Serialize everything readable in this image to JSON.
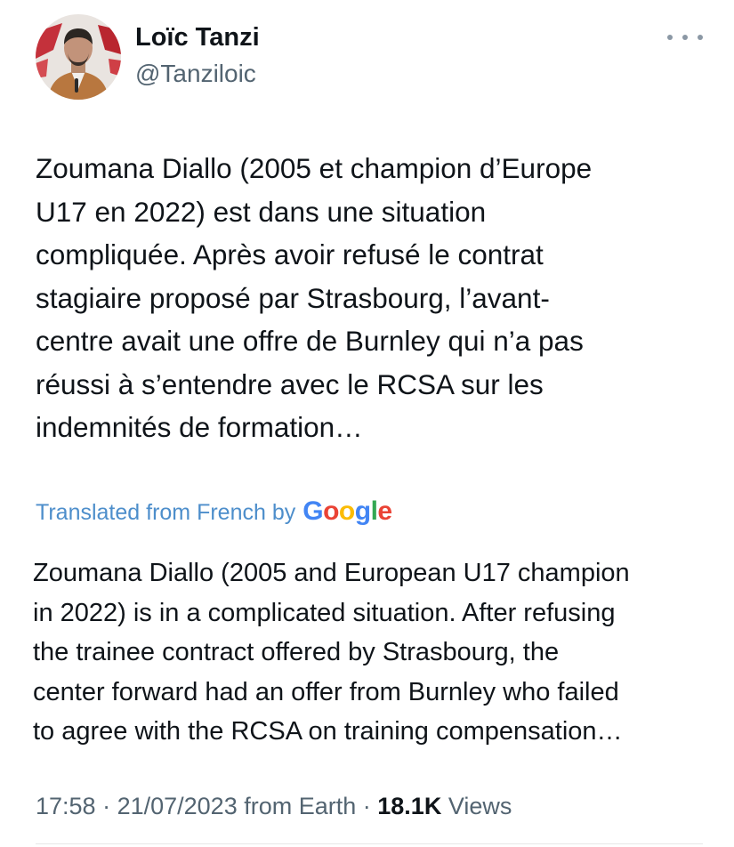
{
  "author": {
    "display_name": "Loïc Tanzi",
    "handle": "@Tanziloic"
  },
  "more_icon": "more-horizontal-icon",
  "tweet": {
    "original_lines": [
      "Zoumana Diallo (2005 et champion d’Europe",
      "U17 en 2022) est dans une situation",
      "compliquée. Après avoir refusé le contrat",
      "stagiaire proposé par Strasbourg, l’avant-",
      "centre avait une offre de Burnley qui n’a pas",
      "réussi à s’entendre avec le RCSA sur les",
      "indemnités de formation…"
    ],
    "translated_from": "Translated from French by",
    "translator_logo": "Google",
    "translated_lines": [
      "Zoumana Diallo (2005 and European U17 champion",
      "in 2022) is in a complicated situation. After refusing",
      "the trainee contract offered by Strasbourg, the",
      "center forward had an offer from Burnley who failed",
      "to agree with the RCSA on training compensation…"
    ]
  },
  "meta": {
    "time": "17:58",
    "sep1": " · ",
    "date": "21/07/2023",
    "source": " from Earth",
    "sep2": " · ",
    "views_count": "18.1K",
    "views_label": " Views"
  },
  "colors": {
    "link": "#4d8ecb",
    "secondary_text": "#536471",
    "google_blue": "#4285f4",
    "google_red": "#ea4335",
    "google_yellow": "#fbbc05",
    "google_green": "#34a853"
  }
}
